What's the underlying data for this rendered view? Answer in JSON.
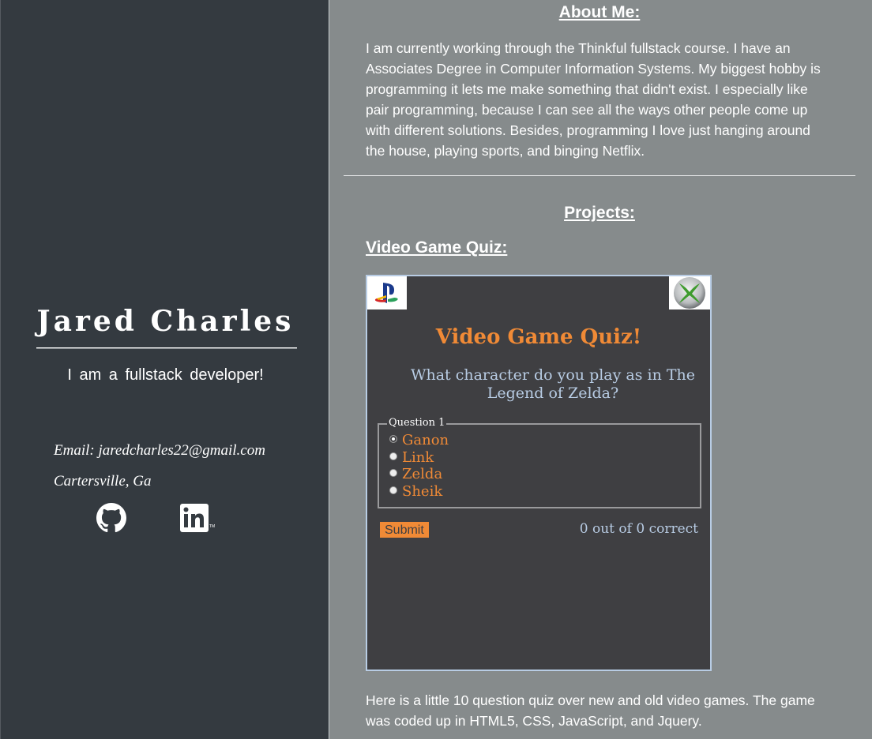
{
  "sidebar": {
    "name": "Jared Charles",
    "tagline": "I am a fullstack developer!",
    "email": "Email: jaredcharles22@gmail.com",
    "location": "Cartersville, Ga",
    "social": [
      {
        "icon": "github-icon"
      },
      {
        "icon": "linkedin-icon"
      }
    ]
  },
  "about": {
    "heading": "About Me:",
    "text": "I am currently working through the Thinkful fullstack course. I have an Associates Degree in Computer Information Systems. My biggest hobby is programming it lets me make something that didn't exist. I especially like pair programming, because I can see all the ways other people come up with different solutions. Besides, programming I love just hanging around the house, playing sports, and binging Netflix."
  },
  "projects": {
    "heading": "Projects:",
    "items": [
      {
        "title": "Video Game Quiz:",
        "description": "Here is a little 10 question quiz over new and old video games. The game was coded up in HTML5, CSS, JavaScript, and Jquery.",
        "screenshot": {
          "title": "Video Game Quiz!",
          "question": "What character do you play as in The Legend of Zelda?",
          "legend": "Question 1",
          "options": [
            "Ganon",
            "Link",
            "Zelda",
            "Sheik"
          ],
          "selected": "Ganon",
          "submit_label": "Submit",
          "score": "0 out of 0 correct",
          "accent_color": "#f08a36",
          "text_color": "#b8cce4"
        }
      }
    ]
  },
  "colors": {
    "sidebar_bg": "#343a40",
    "main_bg": "#868b8c"
  }
}
